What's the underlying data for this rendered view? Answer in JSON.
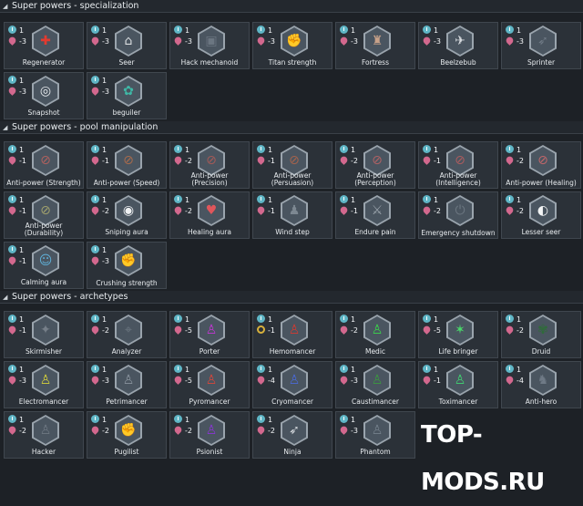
{
  "sections": [
    {
      "title": "Super powers - specialization"
    },
    {
      "title": "Super powers - pool manipulation"
    },
    {
      "title": "Super powers - archetypes"
    }
  ],
  "specialization": [
    {
      "name": "Regenerator",
      "xp": "1",
      "cost": "-3",
      "color": "#e23a2f",
      "glyph": "✚",
      "icon": "regenerator-icon"
    },
    {
      "name": "Seer",
      "xp": "1",
      "cost": "-3",
      "color": "#d9dde0",
      "glyph": "⌂",
      "icon": "seer-icon"
    },
    {
      "name": "Hack mechanoid",
      "xp": "1",
      "cost": "-3",
      "color": "#6b7681",
      "glyph": "▣",
      "icon": "hack-mechanoid-icon"
    },
    {
      "name": "Titan strength",
      "xp": "1",
      "cost": "-3",
      "color": "#e85c8b",
      "glyph": "✊",
      "icon": "titan-strength-icon"
    },
    {
      "name": "Fortress",
      "xp": "1",
      "cost": "-3",
      "color": "#c7a189",
      "glyph": "♜",
      "icon": "fortress-icon"
    },
    {
      "name": "Beelzebub",
      "xp": "1",
      "cost": "-3",
      "color": "#d6dade",
      "glyph": "✈",
      "icon": "beelzebub-icon"
    },
    {
      "name": "Sprinter",
      "xp": "1",
      "cost": "-3",
      "color": "#6f7a85",
      "glyph": "➶",
      "icon": "sprinter-icon"
    },
    {
      "name": "Snapshot",
      "xp": "1",
      "cost": "-3",
      "color": "#e9ecef",
      "glyph": "◎",
      "icon": "snapshot-icon"
    },
    {
      "name": "beguiler",
      "xp": "1",
      "cost": "-3",
      "color": "#3fb8a6",
      "glyph": "✿",
      "icon": "beguiler-icon"
    }
  ],
  "pool": [
    {
      "name": "Anti-power (Strength)",
      "xp": "1",
      "cost": "-1",
      "color": "#b0615e",
      "glyph": "⊘",
      "icon": "anti-power-strength-icon"
    },
    {
      "name": "Anti-power (Speed)",
      "xp": "1",
      "cost": "-1",
      "color": "#a86b4c",
      "glyph": "⊘",
      "icon": "anti-power-speed-icon"
    },
    {
      "name": "Anti-power (Precision)",
      "xp": "1",
      "cost": "-2",
      "color": "#a55a57",
      "glyph": "⊘",
      "icon": "anti-power-precision-icon"
    },
    {
      "name": "Anti-power (Persuasion)",
      "xp": "1",
      "cost": "-1",
      "color": "#a5634c",
      "glyph": "⊘",
      "icon": "anti-power-persuasion-icon"
    },
    {
      "name": "Anti-power (Perception)",
      "xp": "1",
      "cost": "-2",
      "color": "#b06264",
      "glyph": "⊘",
      "icon": "anti-power-perception-icon"
    },
    {
      "name": "Anti-power (Intelligence)",
      "xp": "1",
      "cost": "-1",
      "color": "#ad5c5e",
      "glyph": "⊘",
      "icon": "anti-power-intelligence-icon"
    },
    {
      "name": "Anti-power (Healing)",
      "xp": "1",
      "cost": "-2",
      "color": "#c0666a",
      "glyph": "⊘",
      "icon": "anti-power-healing-icon"
    },
    {
      "name": "Anti-power (Durability)",
      "xp": "1",
      "cost": "-1",
      "color": "#a1a16d",
      "glyph": "⊘",
      "icon": "anti-power-durability-icon"
    },
    {
      "name": "Sniping aura",
      "xp": "1",
      "cost": "-2",
      "color": "#eef0f2",
      "glyph": "◉",
      "icon": "sniping-aura-icon"
    },
    {
      "name": "Healing aura",
      "xp": "1",
      "cost": "-2",
      "color": "#e0565b",
      "glyph": "♥",
      "icon": "healing-aura-icon"
    },
    {
      "name": "Wind step",
      "xp": "1",
      "cost": "-1",
      "color": "#7d8892",
      "glyph": "♟",
      "icon": "wind-step-icon"
    },
    {
      "name": "Endure pain",
      "xp": "1",
      "cost": "-1",
      "color": "#9aa3ab",
      "glyph": "⚔",
      "icon": "endure-pain-icon"
    },
    {
      "name": "Emergency shutdown",
      "xp": "1",
      "cost": "-2",
      "color": "#6c7781",
      "glyph": "⏻",
      "icon": "emergency-shutdown-icon"
    },
    {
      "name": "Lesser seer",
      "xp": "1",
      "cost": "-2",
      "color": "#f2f4f5",
      "glyph": "◐",
      "icon": "lesser-seer-icon"
    },
    {
      "name": "Calming aura",
      "xp": "1",
      "cost": "-1",
      "color": "#5fb0d8",
      "glyph": "☺",
      "icon": "calming-aura-icon"
    },
    {
      "name": "Crushing strength",
      "xp": "1",
      "cost": "-3",
      "color": "#7a8691",
      "glyph": "✊",
      "icon": "crushing-strength-icon"
    }
  ],
  "archetypes": [
    {
      "name": "Skirmisher",
      "xp": "1",
      "cost": "-1",
      "color": "#767f89",
      "glyph": "✦",
      "icon": "skirmisher-icon"
    },
    {
      "name": "Analyzer",
      "xp": "1",
      "cost": "-2",
      "color": "#6d7781",
      "glyph": "⌖",
      "icon": "analyzer-icon"
    },
    {
      "name": "Porter",
      "xp": "1",
      "cost": "-5",
      "color": "#c436d6",
      "glyph": "♙",
      "icon": "porter-icon"
    },
    {
      "name": "Hemomancer",
      "xp": "1",
      "cost": "-1",
      "color": "#d63a31",
      "glyph": "♙",
      "icon": "hemomancer-icon",
      "gold": true
    },
    {
      "name": "Medic",
      "xp": "1",
      "cost": "-2",
      "color": "#3ad64a",
      "glyph": "♙",
      "icon": "medic-icon"
    },
    {
      "name": "Life bringer",
      "xp": "1",
      "cost": "-5",
      "color": "#49d96a",
      "glyph": "✶",
      "icon": "life-bringer-icon"
    },
    {
      "name": "Druid",
      "xp": "1",
      "cost": "-2",
      "color": "#2f6b3a",
      "glyph": "✾",
      "icon": "druid-icon"
    },
    {
      "name": "Electromancer",
      "xp": "1",
      "cost": "-3",
      "color": "#d6d23a",
      "glyph": "♙",
      "icon": "electromancer-icon"
    },
    {
      "name": "Petrimancer",
      "xp": "1",
      "cost": "-3",
      "color": "#8a949e",
      "glyph": "♙",
      "icon": "petrimancer-icon"
    },
    {
      "name": "Pyromancer",
      "xp": "1",
      "cost": "-5",
      "color": "#d9463a",
      "glyph": "♙",
      "icon": "pyromancer-icon"
    },
    {
      "name": "Cryomancer",
      "xp": "1",
      "cost": "-4",
      "color": "#4a6ad8",
      "glyph": "♙",
      "icon": "cryomancer-icon"
    },
    {
      "name": "Caustimancer",
      "xp": "1",
      "cost": "-3",
      "color": "#3b9a3f",
      "glyph": "♙",
      "icon": "caustimancer-icon"
    },
    {
      "name": "Toximancer",
      "xp": "1",
      "cost": "-1",
      "color": "#3fd672",
      "glyph": "♙",
      "icon": "toximancer-icon"
    },
    {
      "name": "Anti-hero",
      "xp": "1",
      "cost": "-4",
      "color": "#6f7a86",
      "glyph": "♞",
      "icon": "anti-hero-icon"
    },
    {
      "name": "Hacker",
      "xp": "1",
      "cost": "-2",
      "color": "#6e7882",
      "glyph": "♙",
      "icon": "hacker-icon"
    },
    {
      "name": "Pugilist",
      "xp": "1",
      "cost": "-2",
      "color": "#eef0f2",
      "glyph": "✊",
      "icon": "pugilist-icon"
    },
    {
      "name": "Psionist",
      "xp": "1",
      "cost": "-2",
      "color": "#8a35d6",
      "glyph": "♙",
      "icon": "psionist-icon"
    },
    {
      "name": "Ninja",
      "xp": "1",
      "cost": "-2",
      "color": "#d6dade",
      "glyph": "➶",
      "icon": "ninja-icon"
    },
    {
      "name": "Phantom",
      "xp": "1",
      "cost": "-3",
      "color": "#74808b",
      "glyph": "♙",
      "icon": "phantom-icon"
    }
  ],
  "watermark": "TOP-MODS.RU"
}
